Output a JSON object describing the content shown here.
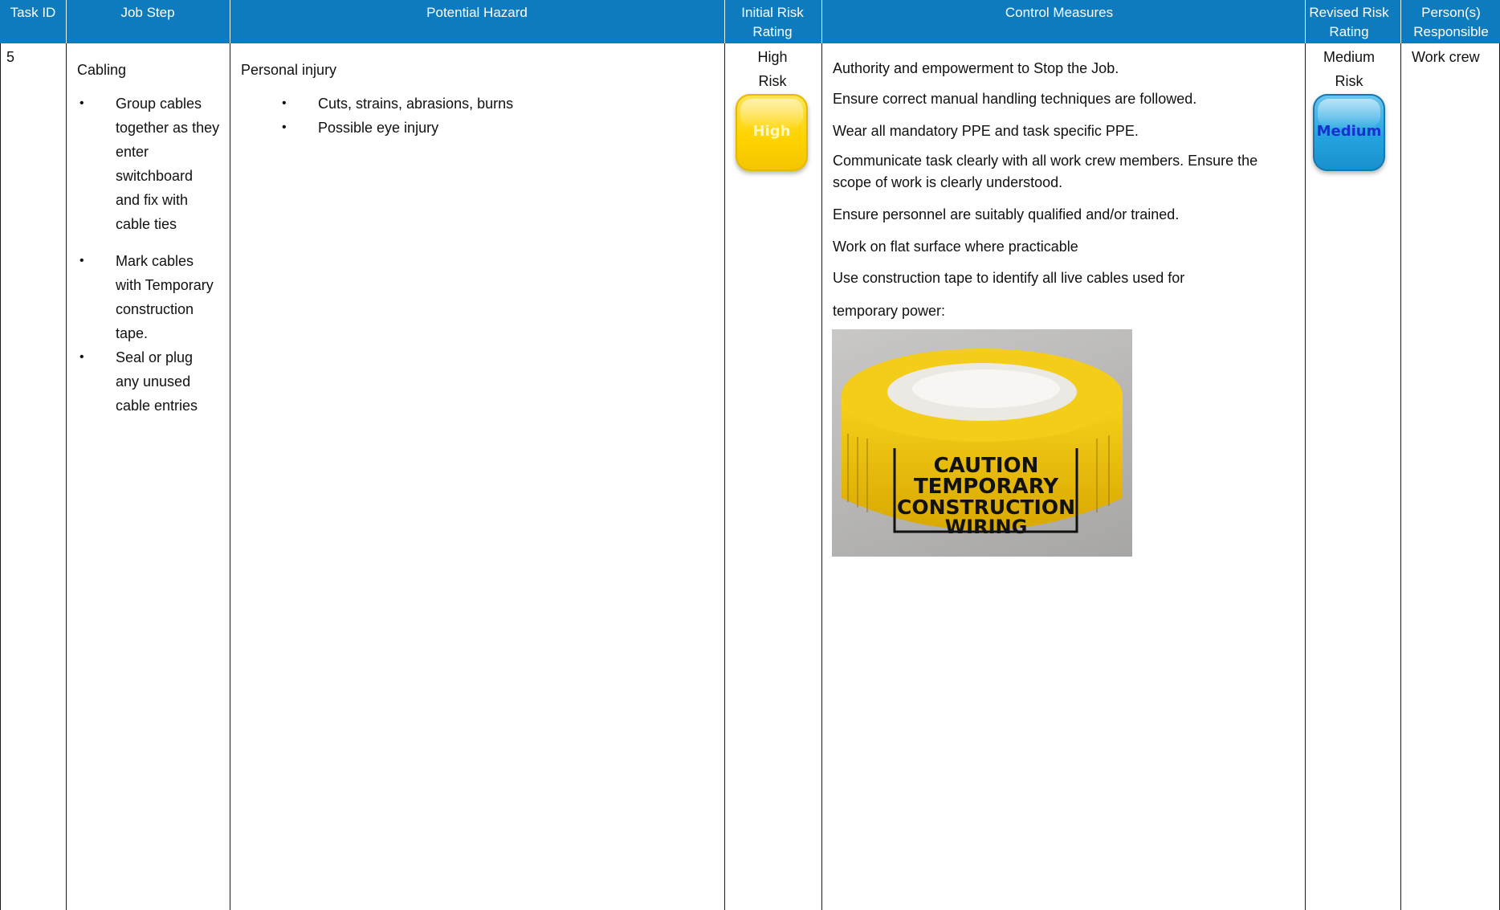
{
  "headers": {
    "task_id": "Task ID",
    "job_step": "Job Step",
    "potential_hazard": "Potential Hazard",
    "initial_risk": "Initial Risk Rating",
    "control_measures": "Control Measures",
    "revised_risk": "Revised Risk Rating",
    "responsible": "Person(s) Responsible"
  },
  "row": {
    "task_id": "5",
    "job_step": {
      "title": "Cabling",
      "items": [
        "Group cables together as they enter switchboard and fix with cable ties",
        "Mark cables with Temporary construction tape.",
        "Seal or plug any unused cable entries"
      ]
    },
    "hazard": {
      "title": "Personal injury",
      "items": [
        "Cuts, strains, abrasions, burns",
        "Possible eye injury"
      ]
    },
    "initial_risk": {
      "text": "High Risk",
      "badge": "High",
      "color": "#ffd400"
    },
    "controls": [
      "Authority and empowerment to Stop the Job.",
      "Ensure correct manual handling techniques are followed.",
      "Wear all mandatory PPE and task specific PPE.",
      "Communicate task clearly with all work crew members.  Ensure the scope of work is clearly understood.",
      "Ensure personnel are suitably qualified and/or trained.",
      "Work on flat surface where practicable",
      "Use construction tape to identify all live cables used for",
      "temporary power:"
    ],
    "tape_photo": {
      "lines": [
        "CAUTION",
        "TEMPORARY",
        "CONSTRUCTION",
        "WIRING"
      ]
    },
    "revised_risk": {
      "text": "Medium Risk",
      "badge": "Medium",
      "color": "#23a4e0"
    },
    "responsible": "Work crew"
  },
  "colors": {
    "header_bg": "#0f7bbf",
    "header_text": "#ffffff",
    "tape": "#f5c800"
  }
}
